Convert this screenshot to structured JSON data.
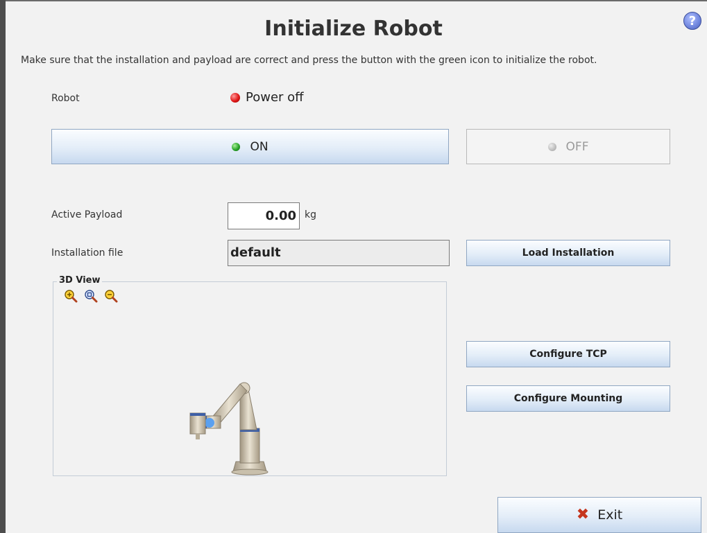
{
  "page": {
    "title": "Initialize Robot",
    "subtitle": "Make sure that the installation and payload are correct and press the button with the green icon to initialize the robot.",
    "help_symbol": "?"
  },
  "robot_status": {
    "label": "Robot",
    "status_text": "Power off",
    "status_color": "#e01818"
  },
  "power_buttons": {
    "on_label": "ON",
    "on_indicator_color": "#2aa52a",
    "off_label": "OFF",
    "off_indicator_color": "#bdbdbd"
  },
  "payload": {
    "label": "Active Payload",
    "value": "0.00",
    "unit": "kg"
  },
  "installation": {
    "label": "Installation file",
    "value": "default",
    "load_button_label": "Load Installation"
  },
  "view3d": {
    "legend": "3D View",
    "tools": [
      "zoom-in-icon",
      "zoom-fit-icon",
      "zoom-out-icon"
    ]
  },
  "config_buttons": {
    "tcp_label": "Configure TCP",
    "mounting_label": "Configure Mounting"
  },
  "exit": {
    "label": "Exit",
    "icon": "close-icon"
  }
}
